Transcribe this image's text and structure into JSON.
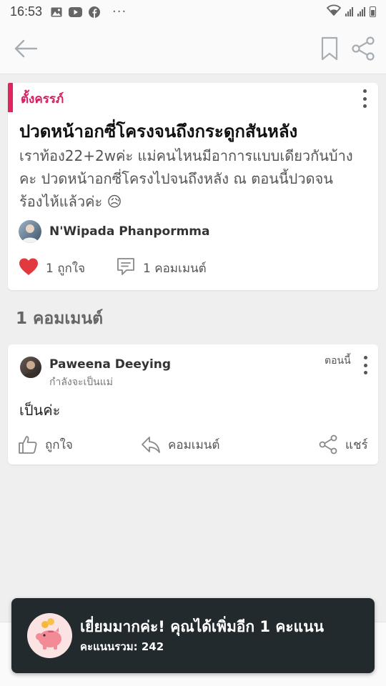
{
  "status_bar": {
    "time": "16:53",
    "icons": [
      "gallery-icon",
      "youtube-icon",
      "facebook-icon",
      "more-icon",
      "wifi-icon",
      "signal-icon",
      "signal-icon",
      "battery-icon"
    ],
    "more": "···"
  },
  "app_bar": {
    "icons": [
      "back-arrow-icon",
      "bookmark-icon",
      "share-icon"
    ],
    "accent": "#b0b6bb"
  },
  "post": {
    "tag": "ตั้งครรภ์",
    "tag_color": "#e0245e",
    "title": "ปวดหน้าอกซี่โครงจนถึงกระดูกสันหลัง",
    "body": "เราท้อง22+2wค่ะ แม่คนไหนมีอาการแบบเดียวกันบ้างคะ ปวดหน้าอกซี่โครงไปจนถึงหลัง ณ ตอนนี้ปวดจนร้องไห้แล้วค่ะ",
    "emoji": "😥",
    "author": "N'Wipada Phanpormma",
    "likes_label": "1 ถูกใจ",
    "comments_label": "1 คอมเมนต์",
    "like_color": "#e0393e"
  },
  "comments_heading": "1 คอมเมนต์",
  "comment": {
    "author": "Paweena Deeying",
    "subtitle": "กำลังจะเป็นแม่",
    "time": "ตอนนี้",
    "text": "เป็นค่ะ",
    "actions": {
      "like": "ถูกใจ",
      "reply": "คอมเมนต์",
      "share": "แชร์"
    }
  },
  "toast": {
    "headline": "เยี่ยมมากค่ะ! คุณได้เพิ่มอีก 1 คะแนน",
    "score_label": "คะแนนรวม: 242",
    "icon": "piggy-bank-icon",
    "background": "#222a2e"
  }
}
